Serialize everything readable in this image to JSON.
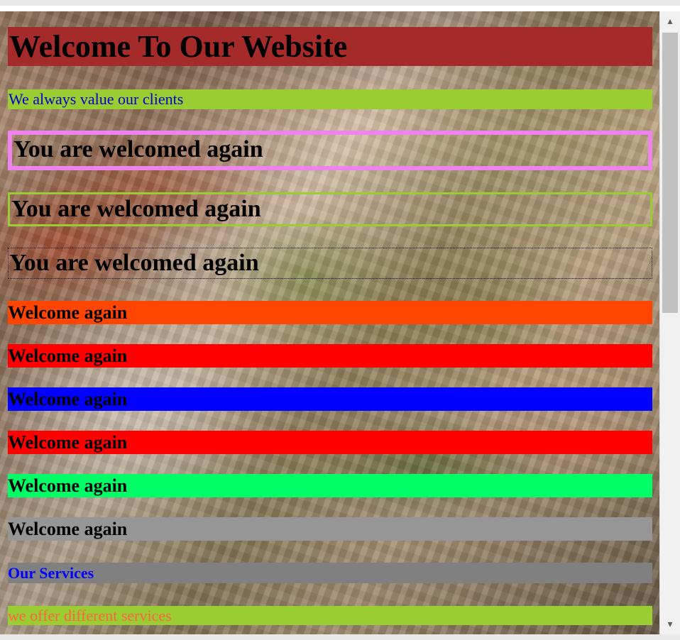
{
  "page": {
    "title": "Welcome To Our Website",
    "subtitle": "We always value our clients",
    "boxed_messages": [
      "You are welcomed again",
      "You are welcomed again",
      "You are welcomed again"
    ],
    "welcome_bars": [
      "Welcome again",
      "Welcome again",
      "Welcome again",
      "Welcome again",
      "Welcome again",
      "Welcome again"
    ],
    "services_title": "Our Services",
    "services_desc": "we offer different services"
  },
  "colors": {
    "title_bg": "#a52a2a",
    "subtitle_bg": "#9acd32",
    "subtitle_text": "#0000cd",
    "box1_border": "#ee82ee",
    "box2_border": "#9acd32",
    "box3_border": "#000000",
    "bar_colors": [
      "#ff4500",
      "#ff0000",
      "#0000ff",
      "#ff0000",
      "#00ff66",
      "#969696"
    ],
    "services_bg": "#808080",
    "services_text": "#0000ff",
    "services_desc_bg": "#9acd32",
    "services_desc_text": "#ff6347"
  },
  "scrollbar": {
    "up_icon": "chevron-up-icon",
    "down_icon": "chevron-down-icon"
  }
}
